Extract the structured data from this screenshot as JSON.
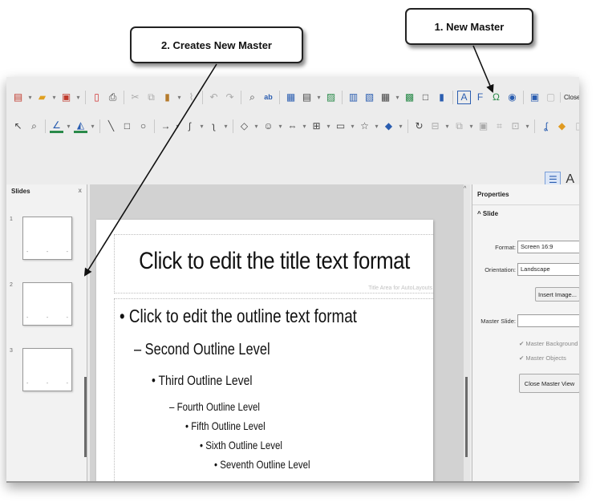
{
  "callouts": {
    "new_master": "1. New Master",
    "creates_new_master": "2. Creates New Master"
  },
  "toolbar": {
    "close_master_view": "Close Master View"
  },
  "slides_panel": {
    "title": "Slides",
    "close": "x",
    "thumbnails": [
      "1",
      "2",
      "3"
    ],
    "dash": "-"
  },
  "slide": {
    "title": "Click to edit the title text format",
    "title_area_label": "Title Area for AutoLayouts",
    "outline": [
      "• Click to edit the outline text format",
      "– Second Outline Level",
      "• Third Outline Level",
      "– Fourth Outline Level",
      "• Fifth Outline Level",
      "• Sixth Outline Level",
      "• Seventh Outline Level"
    ]
  },
  "properties": {
    "title": "Properties",
    "section": "^ Slide",
    "format_label": "Format:",
    "format_value": "Screen 16:9",
    "orientation_label": "Orientation:",
    "orientation_value": "Landscape",
    "insert_image": "Insert Image...",
    "master_slide_label": "Master Slide:",
    "master_slide_value": "",
    "master_background": "Master Background",
    "master_objects": "Master Objects",
    "close_master_view": "Close Master View",
    "check": "✔"
  },
  "icons": {
    "text_a": "A"
  },
  "colors": {
    "arrow": "#111111",
    "canvas": "#d2d2d2",
    "panel": "#f2f2f2"
  }
}
